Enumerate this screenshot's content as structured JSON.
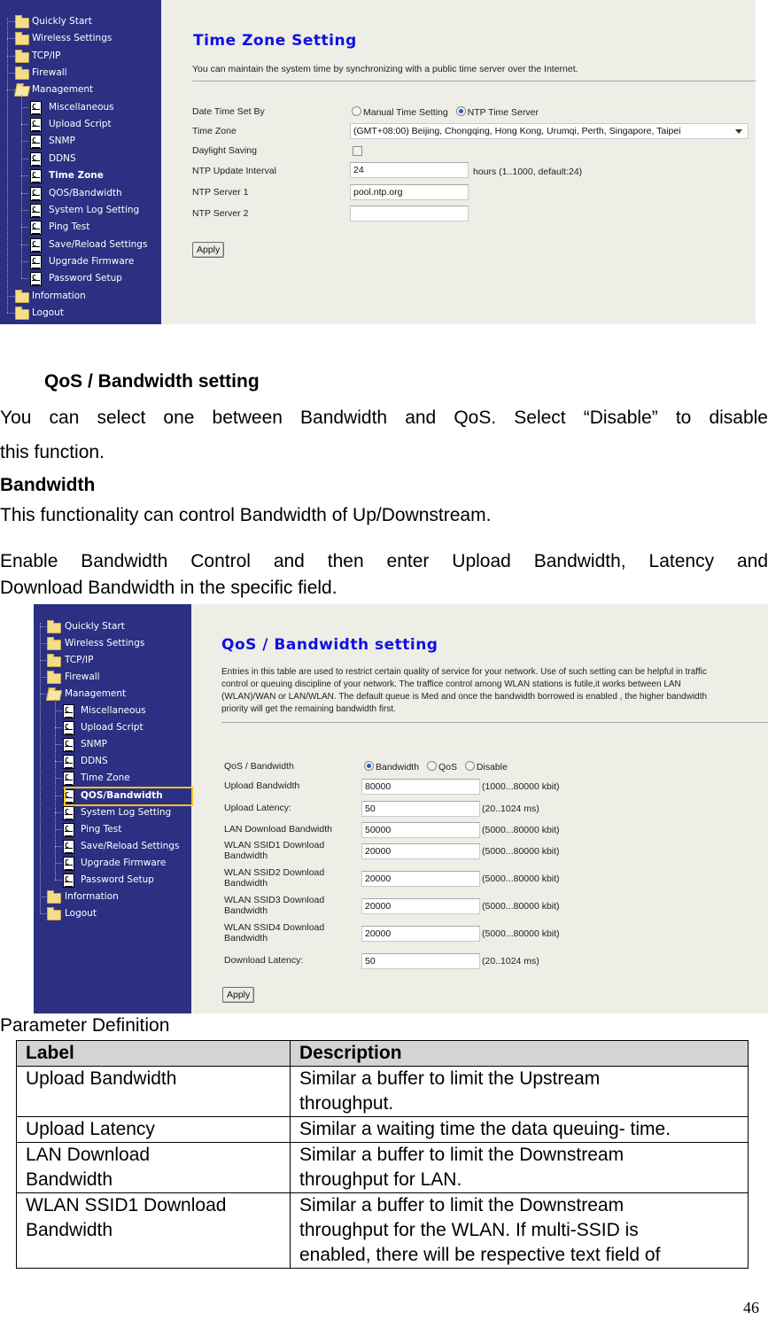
{
  "screenshot1": {
    "sidebar": [
      {
        "label": "Quickly Start",
        "type": "folder",
        "level": 0
      },
      {
        "label": "Wireless Settings",
        "type": "folder",
        "level": 0
      },
      {
        "label": "TCP/IP",
        "type": "folder",
        "level": 0
      },
      {
        "label": "Firewall",
        "type": "folder",
        "level": 0
      },
      {
        "label": "Management",
        "type": "folder-open",
        "level": 0
      },
      {
        "label": "Miscellaneous",
        "type": "doc",
        "level": 1
      },
      {
        "label": "Upload Script",
        "type": "doc",
        "level": 1
      },
      {
        "label": "SNMP",
        "type": "doc",
        "level": 1
      },
      {
        "label": "DDNS",
        "type": "doc",
        "level": 1
      },
      {
        "label": "Time Zone",
        "type": "doc",
        "level": 1,
        "active": true
      },
      {
        "label": "QOS/Bandwidth",
        "type": "doc",
        "level": 1
      },
      {
        "label": "System Log Setting",
        "type": "doc",
        "level": 1
      },
      {
        "label": "Ping Test",
        "type": "doc",
        "level": 1
      },
      {
        "label": "Save/Reload Settings",
        "type": "doc",
        "level": 1
      },
      {
        "label": "Upgrade Firmware",
        "type": "doc",
        "level": 1
      },
      {
        "label": "Password Setup",
        "type": "doc",
        "level": 1
      },
      {
        "label": "Information",
        "type": "folder",
        "level": 0
      },
      {
        "label": "Logout",
        "type": "folder",
        "level": 0
      }
    ],
    "title": "Time Zone Setting",
    "intro": "You can maintain the system time by synchronizing with a public time server over the Internet.",
    "fields": {
      "date_time_set_by": {
        "label": "Date Time Set By",
        "options": [
          {
            "label": "Manual Time Setting",
            "selected": false
          },
          {
            "label": "NTP Time Server",
            "selected": true
          }
        ]
      },
      "time_zone": {
        "label": "Time Zone",
        "value": "(GMT+08:00) Beijing, Chongqing, Hong Kong, Urumqi, Perth, Singapore, Taipei"
      },
      "daylight_saving": {
        "label": "Daylight Saving",
        "checked": false
      },
      "ntp_update_interval": {
        "label": "NTP Update Interval",
        "value": "24",
        "hint": "hours (1..1000, default:24)"
      },
      "ntp_server_1": {
        "label": "NTP Server 1",
        "value": "pool.ntp.org"
      },
      "ntp_server_2": {
        "label": "NTP Server 2",
        "value": ""
      }
    },
    "apply_label": "Apply"
  },
  "section": {
    "heading": "QoS / Bandwidth setting",
    "para1_line1": "You can select one between Bandwidth and QoS. Select “Disable” to disable",
    "para1_line2": "this function.",
    "subheading": "Bandwidth",
    "para2": "This functionality can control Bandwidth of Up/Downstream.",
    "para3_line1": "Enable Bandwidth Control and then enter Upload Bandwidth, Latency and",
    "para3_line2": "Download Bandwidth in the specific field."
  },
  "screenshot2": {
    "sidebar": [
      {
        "label": "Quickly Start",
        "type": "folder",
        "level": 0
      },
      {
        "label": "Wireless Settings",
        "type": "folder",
        "level": 0
      },
      {
        "label": "TCP/IP",
        "type": "folder",
        "level": 0
      },
      {
        "label": "Firewall",
        "type": "folder",
        "level": 0
      },
      {
        "label": "Management",
        "type": "folder-open",
        "level": 0
      },
      {
        "label": "Miscellaneous",
        "type": "doc",
        "level": 1
      },
      {
        "label": "Upload Script",
        "type": "doc",
        "level": 1
      },
      {
        "label": "SNMP",
        "type": "doc",
        "level": 1
      },
      {
        "label": "DDNS",
        "type": "doc",
        "level": 1
      },
      {
        "label": "Time Zone",
        "type": "doc",
        "level": 1
      },
      {
        "label": "QOS/Bandwidth",
        "type": "doc",
        "level": 1,
        "active": true,
        "highlighted": true
      },
      {
        "label": "System Log Setting",
        "type": "doc",
        "level": 1
      },
      {
        "label": "Ping Test",
        "type": "doc",
        "level": 1
      },
      {
        "label": "Save/Reload Settings",
        "type": "doc",
        "level": 1
      },
      {
        "label": "Upgrade Firmware",
        "type": "doc",
        "level": 1
      },
      {
        "label": "Password Setup",
        "type": "doc",
        "level": 1
      },
      {
        "label": "Information",
        "type": "folder",
        "level": 0
      },
      {
        "label": "Logout",
        "type": "folder",
        "level": 0
      }
    ],
    "title": "QoS / Bandwidth setting",
    "intro_lines": [
      "Entries in this table are used to restrict certain quality of service for your network. Use of such setting can be helpful in traffic",
      "control or queuing discipline of your network. The traffice control among WLAN stations is futile,it works between LAN",
      "(WLAN)/WAN or LAN/WLAN. The default queue is Med and once the bandwidth borrowed is enabled , the higher bandwidth",
      "priority will get the remaining bandwidth first."
    ],
    "mode": {
      "label": "QoS / Bandwidth",
      "options": [
        {
          "label": "Bandwidth",
          "selected": true
        },
        {
          "label": "QoS",
          "selected": false
        },
        {
          "label": "Disable",
          "selected": false
        }
      ]
    },
    "fields": [
      {
        "label_lines": [
          "Upload Bandwidth"
        ],
        "value": "80000",
        "hint": "(1000...80000 kbit)"
      },
      {
        "label_lines": [
          "Upload Latency:"
        ],
        "value": "50",
        "hint": "(20..1024 ms)"
      },
      {
        "label_lines": [
          "LAN Download Bandwidth"
        ],
        "value": "50000",
        "hint": "(5000...80000 kbit)"
      },
      {
        "label_lines": [
          "WLAN SSID1 Download",
          "Bandwidth"
        ],
        "value": "20000",
        "hint": "(5000...80000 kbit)"
      },
      {
        "label_lines": [
          "WLAN SSID2 Download",
          "Bandwidth"
        ],
        "value": "20000",
        "hint": "(5000...80000 kbit)"
      },
      {
        "label_lines": [
          "WLAN SSID3 Download",
          "Bandwidth"
        ],
        "value": "20000",
        "hint": "(5000...80000 kbit)"
      },
      {
        "label_lines": [
          "WLAN SSID4 Download",
          "Bandwidth"
        ],
        "value": "20000",
        "hint": "(5000...80000 kbit)"
      },
      {
        "label_lines": [
          "Download Latency:"
        ],
        "value": "50",
        "hint": "(20..1024 ms)"
      }
    ],
    "apply_label": "Apply"
  },
  "param_table": {
    "caption": "Parameter Definition",
    "headers": [
      "Label",
      "Description"
    ],
    "rows": [
      {
        "label_lines": [
          "Upload Bandwidth"
        ],
        "desc_lines": [
          "Similar a buffer to limit the Upstream",
          "throughput."
        ]
      },
      {
        "label_lines": [
          "Upload Latency"
        ],
        "desc_lines": [
          "Similar a waiting time the data queuing- time."
        ]
      },
      {
        "label_lines": [
          "LAN Download",
          "Bandwidth"
        ],
        "desc_lines": [
          "Similar a buffer to limit the Downstream",
          "throughput for LAN."
        ]
      },
      {
        "label_lines": [
          "WLAN SSID1 Download",
          "Bandwidth"
        ],
        "desc_lines": [
          "Similar a buffer to limit the Downstream",
          "throughput for the WLAN. If multi-SSID is",
          "enabled, there will be respective text field of"
        ]
      }
    ]
  },
  "page_number": "46"
}
